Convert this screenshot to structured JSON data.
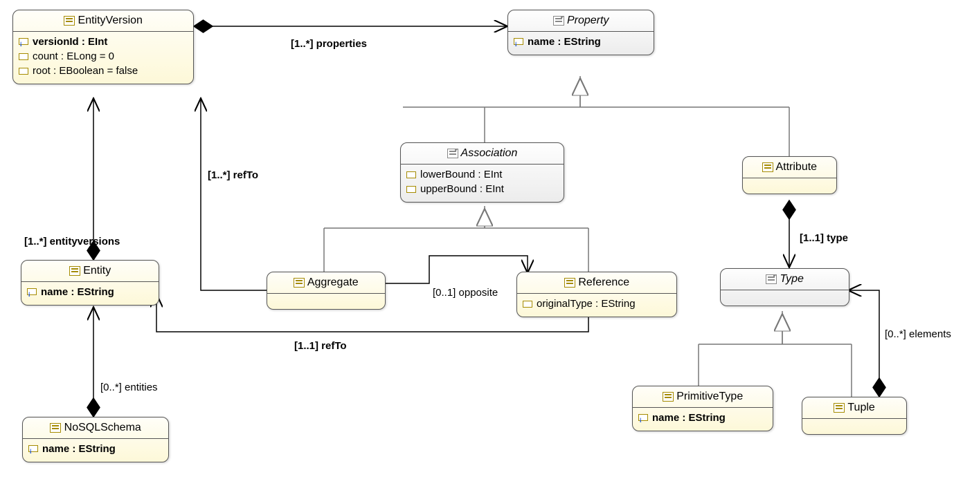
{
  "classes": {
    "entityVersion": {
      "name": "EntityVersion",
      "attrs": {
        "versionId": "versionId : EInt",
        "count": "count : ELong = 0",
        "root": "root : EBoolean = false"
      }
    },
    "property": {
      "name": "Property",
      "attrs": {
        "name": "name : EString"
      }
    },
    "association": {
      "name": "Association",
      "attrs": {
        "lowerBound": "lowerBound : EInt",
        "upperBound": "upperBound : EInt"
      }
    },
    "attribute": {
      "name": "Attribute"
    },
    "entity": {
      "name": "Entity",
      "attrs": {
        "name": "name : EString"
      }
    },
    "aggregate": {
      "name": "Aggregate"
    },
    "reference": {
      "name": "Reference",
      "attrs": {
        "originalType": "originalType : EString"
      }
    },
    "type": {
      "name": "Type"
    },
    "primitiveType": {
      "name": "PrimitiveType",
      "attrs": {
        "name": "name : EString"
      }
    },
    "tuple": {
      "name": "Tuple"
    },
    "noSqlSchema": {
      "name": "NoSQLSchema",
      "attrs": {
        "name": "name : EString"
      }
    }
  },
  "edges": {
    "properties": "[1..*] properties",
    "refToAgg": "[1..*] refTo",
    "entityversions": "[1..*] entityversions",
    "opposite": "[0..1] opposite",
    "refToRef": "[1..1] refTo",
    "typeRel": "[1..1] type",
    "elements": "[0..*] elements",
    "entities": "[0..*] entities"
  }
}
